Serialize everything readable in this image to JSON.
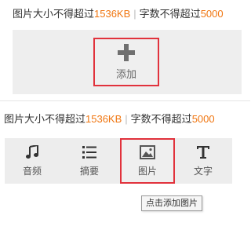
{
  "top_panel": {
    "limit_prefix_1": "图片大小不得超过",
    "size_limit": "1536KB",
    "separator": "|",
    "limit_prefix_2": "字数不得超过",
    "word_limit": "5000",
    "add_button": {
      "label": "添加",
      "icon": "plus-icon"
    }
  },
  "bottom_panel": {
    "limit_prefix_1": "图片大小不得超过",
    "size_limit": "1536KB",
    "separator": "|",
    "limit_prefix_2": "字数不得超过",
    "word_limit": "5000",
    "tools": [
      {
        "label": "音频",
        "icon": "music-note-icon"
      },
      {
        "label": "摘要",
        "icon": "list-icon"
      },
      {
        "label": "图片",
        "icon": "image-icon",
        "active": true
      },
      {
        "label": "文字",
        "icon": "text-icon"
      }
    ],
    "tooltip": "点击添加图片"
  },
  "colors": {
    "accent_orange": "#f0750f",
    "highlight_red": "#e1323c",
    "panel_gray": "#eeeeee"
  }
}
